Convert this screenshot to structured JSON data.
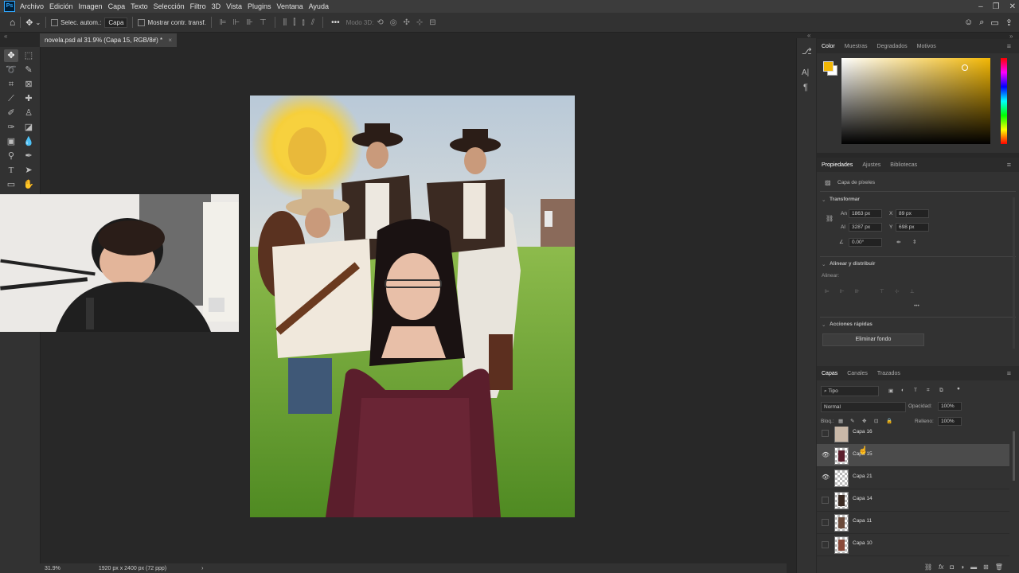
{
  "menu": [
    "Archivo",
    "Edición",
    "Imagen",
    "Capa",
    "Texto",
    "Selección",
    "Filtro",
    "3D",
    "Vista",
    "Plugins",
    "Ventana",
    "Ayuda"
  ],
  "options": {
    "auto_select": "Selec. autom.:",
    "auto_select_value": "Capa",
    "show_transform": "Mostrar contr. transf.",
    "mode3d": "Modo 3D:"
  },
  "document": {
    "tab_title": "novela.psd al 31.9% (Capa 15, RGB/8#) *",
    "zoom": "31.9%",
    "dimensions": "1920 px x 2400 px (72 ppp)"
  },
  "color_panel": {
    "tabs": [
      "Color",
      "Muestras",
      "Degradados",
      "Motivos"
    ],
    "foreground": "#f2b705",
    "background": "#ffffff"
  },
  "properties": {
    "tabs": [
      "Propiedades",
      "Ajustes",
      "Bibliotecas"
    ],
    "type": "Capa de píxeles",
    "transform_title": "Transformar",
    "w_label": "An",
    "w_value": "1863 px",
    "x_label": "X",
    "x_value": "89 px",
    "h_label": "Al",
    "h_value": "3287 px",
    "y_label": "Y",
    "y_value": "698 px",
    "angle": "0.00°",
    "align_title": "Alinear y distribuir",
    "align_label": "Alinear:",
    "quick_title": "Acciones rápidas",
    "remove_bg": "Eliminar fondo"
  },
  "layers_panel": {
    "tabs": [
      "Capas",
      "Canales",
      "Trazados"
    ],
    "filter": "Tipo",
    "blend": "Normal",
    "opacity_label": "Opacidad:",
    "opacity": "100%",
    "lock_label": "Bloq.:",
    "fill_label": "Relleno:",
    "fill": "100%",
    "layers": [
      {
        "name": "Capa 16",
        "visible": false,
        "selected": false
      },
      {
        "name": "Capa 15",
        "visible": true,
        "selected": true
      },
      {
        "name": "Capa 21",
        "visible": true,
        "selected": false
      },
      {
        "name": "Capa 14",
        "visible": false,
        "selected": false
      },
      {
        "name": "Capa 11",
        "visible": false,
        "selected": false
      },
      {
        "name": "Capa 10",
        "visible": false,
        "selected": false
      }
    ]
  }
}
